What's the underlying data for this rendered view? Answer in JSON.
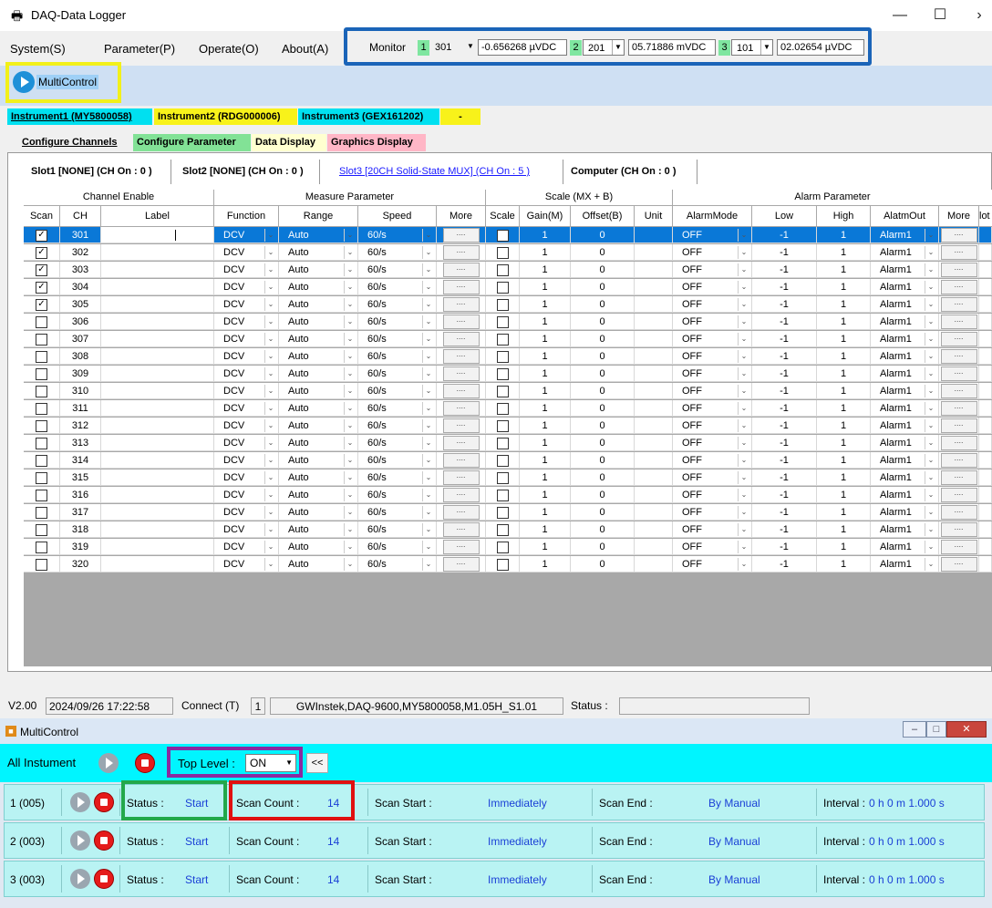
{
  "app": {
    "title": "DAQ-Data Logger"
  },
  "menu": [
    "System(S)",
    "Parameter(P)",
    "Operate(O)",
    "About(A)"
  ],
  "monitor": {
    "label": "Monitor",
    "channels": [
      {
        "num": "1",
        "channel": "301",
        "value": "-0.656268 µVDC"
      },
      {
        "num": "2",
        "channel": "201",
        "value": "05.71886 mVDC"
      },
      {
        "num": "3",
        "channel": "101",
        "value": "02.02654 µVDC"
      }
    ]
  },
  "toolbar": {
    "multicontrol_label": "MultiControl"
  },
  "instrument_tabs": [
    "Instrument1 (MY5800058)",
    "Instrument2 (RDG000006)",
    "Instrument3 (GEX161202)",
    "-"
  ],
  "config_tabs": [
    "Configure Channels",
    "Configure Parameter",
    "Data Display",
    "Graphics Display"
  ],
  "slot_tabs": [
    "Slot1 [NONE] (CH On : 0 )",
    "Slot2 [NONE] (CH On : 0 )",
    "Slot3 [20CH Solid-State MUX] (CH On : 5 )",
    "Computer  (CH On : 0 )"
  ],
  "grid": {
    "groups": [
      "Channel Enable",
      "Measure Parameter",
      "Scale (MX + B)",
      "Alarm Parameter"
    ],
    "columns": [
      "Scan",
      "CH",
      "Label",
      "Function",
      "Range",
      "Speed",
      "More",
      "Scale",
      "Gain(M)",
      "Offset(B)",
      "Unit",
      "AlarmMode",
      "Low",
      "High",
      "AlatmOut",
      "More",
      "lot"
    ],
    "rows": [
      {
        "ch": "301",
        "scan": true
      },
      {
        "ch": "302",
        "scan": true
      },
      {
        "ch": "303",
        "scan": true
      },
      {
        "ch": "304",
        "scan": true
      },
      {
        "ch": "305",
        "scan": true
      },
      {
        "ch": "306",
        "scan": false
      },
      {
        "ch": "307",
        "scan": false
      },
      {
        "ch": "308",
        "scan": false
      },
      {
        "ch": "309",
        "scan": false
      },
      {
        "ch": "310",
        "scan": false
      },
      {
        "ch": "311",
        "scan": false
      },
      {
        "ch": "312",
        "scan": false
      },
      {
        "ch": "313",
        "scan": false
      },
      {
        "ch": "314",
        "scan": false
      },
      {
        "ch": "315",
        "scan": false
      },
      {
        "ch": "316",
        "scan": false
      },
      {
        "ch": "317",
        "scan": false
      },
      {
        "ch": "318",
        "scan": false
      },
      {
        "ch": "319",
        "scan": false
      },
      {
        "ch": "320",
        "scan": false
      }
    ],
    "defaults": {
      "function": "DCV",
      "range": "Auto",
      "speed": "60/s",
      "more": "....",
      "gain": "1",
      "offset": "0",
      "alarm_mode": "OFF",
      "low": "-1",
      "high": "1",
      "alarm_out": "Alarm1"
    }
  },
  "statusbar": {
    "version": "V2.00",
    "datetime": "2024/09/26 17:22:58",
    "connect_label": "Connect (T)",
    "connect_value": "1",
    "device": "GWInstek,DAQ-9600,MY5800058,M1.05H_S1.01",
    "status_label": "Status :"
  },
  "multicontrol": {
    "title": "MultiControl",
    "all_label": "All Instument",
    "top_level_label": "Top Level :",
    "top_level_value": "ON",
    "collapse": "<<",
    "rows": [
      {
        "id": "1 (005)",
        "status_label": "Status :",
        "status": "Start",
        "count_label": "Scan Count :",
        "count": "14",
        "start_label": "Scan Start :",
        "start": "Immediately",
        "end_label": "Scan End :",
        "end": "By Manual",
        "interval_label": "Interval :",
        "interval": "0 h 0 m 1.000 s"
      },
      {
        "id": "2 (003)",
        "status_label": "Status :",
        "status": "Start",
        "count_label": "Scan Count :",
        "count": "14",
        "start_label": "Scan Start :",
        "start": "Immediately",
        "end_label": "Scan End :",
        "end": "By Manual",
        "interval_label": "Interval :",
        "interval": "0 h 0 m 1.000 s"
      },
      {
        "id": "3 (003)",
        "status_label": "Status :",
        "status": "Start",
        "count_label": "Scan Count :",
        "count": "14",
        "start_label": "Scan Start :",
        "start": "Immediately",
        "end_label": "Scan End :",
        "end": "By Manual",
        "interval_label": "Interval :",
        "interval": "0 h 0 m 1.000 s"
      }
    ]
  },
  "colors": {
    "highlight_yellow": "#f2f01a",
    "highlight_blue": "#1a64b8",
    "highlight_green": "#22a84a",
    "highlight_red": "#e01010",
    "highlight_purple": "#8a2aa0",
    "cyan": "#00f5ff"
  }
}
